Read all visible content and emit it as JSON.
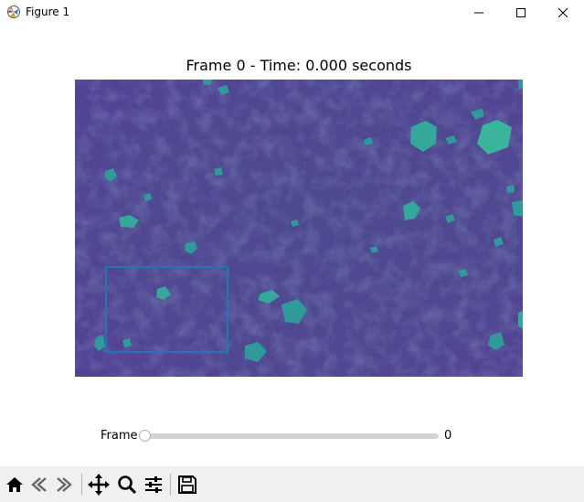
{
  "window": {
    "title": "Figure 1",
    "icons": {
      "app": "matplotlib-icon",
      "minimize": "minimize-icon",
      "maximize": "maximize-icon",
      "close": "close-icon"
    }
  },
  "figure": {
    "title": "Frame 0 - Time: 0.000 seconds",
    "image": {
      "description_colormap": "viridis",
      "background_color": "#433a87",
      "particle_color": "#35b39a",
      "roi_color": "#1f77b4"
    }
  },
  "slider": {
    "label": "Frame",
    "value": "0",
    "position_fraction": 0
  },
  "toolbar": {
    "tools": [
      {
        "name": "home",
        "icon": "home-icon"
      },
      {
        "name": "back",
        "icon": "back-arrow-icon"
      },
      {
        "name": "forward",
        "icon": "forward-arrow-icon"
      },
      {
        "name": "pan",
        "icon": "move-icon"
      },
      {
        "name": "zoom",
        "icon": "zoom-icon"
      },
      {
        "name": "configure-subplots",
        "icon": "sliders-icon"
      },
      {
        "name": "save",
        "icon": "save-icon"
      }
    ]
  },
  "colors": {
    "toolbar_bg": "#f0f0f0",
    "slider_track": "#d3d3d3"
  }
}
